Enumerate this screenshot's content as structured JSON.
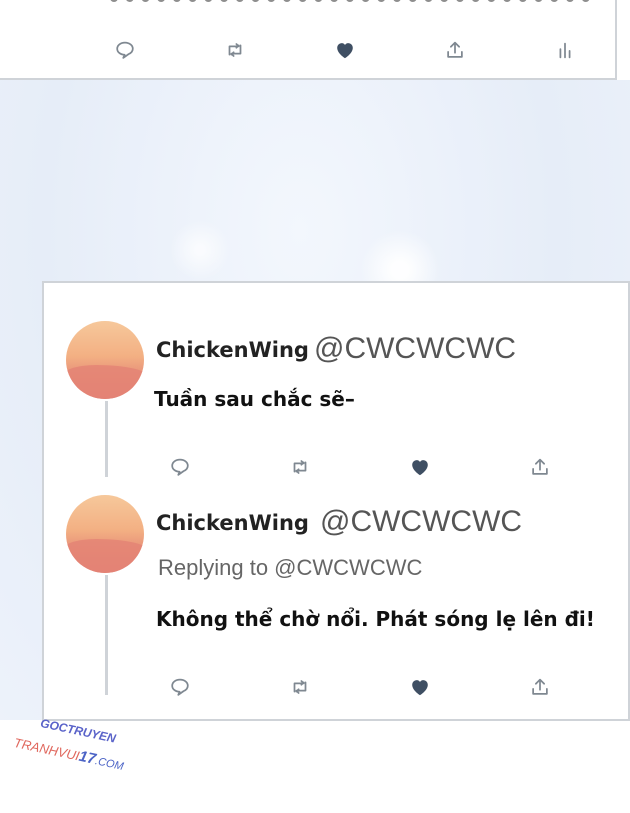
{
  "top_card": {
    "actions": [
      "reply-icon",
      "retweet-icon",
      "heart-icon",
      "share-icon",
      "analytics-icon"
    ]
  },
  "tweets": [
    {
      "display_name": "ChickenWing",
      "handle": "@CWCWCWC",
      "text": "Tuần sau chắc sẽ–",
      "actions": [
        "reply-icon",
        "retweet-icon",
        "heart-icon",
        "share-icon"
      ]
    },
    {
      "display_name": "ChickenWing",
      "handle": "@CWCWCWC",
      "replying_to": "Replying to @CWCWCWC",
      "text": "Không thể chờ nổi. Phát sóng lẹ lên đi!",
      "actions": [
        "reply-icon",
        "retweet-icon",
        "heart-icon",
        "share-icon"
      ]
    }
  ],
  "watermark": {
    "line1": "GOCTRUYEN",
    "line2_a": "TRANHVUI",
    "line2_b": "17",
    "line2_c": ".COM"
  },
  "colors": {
    "icon": "#7f8891",
    "heart": "#3f4f63",
    "border": "#cfd3d8"
  }
}
